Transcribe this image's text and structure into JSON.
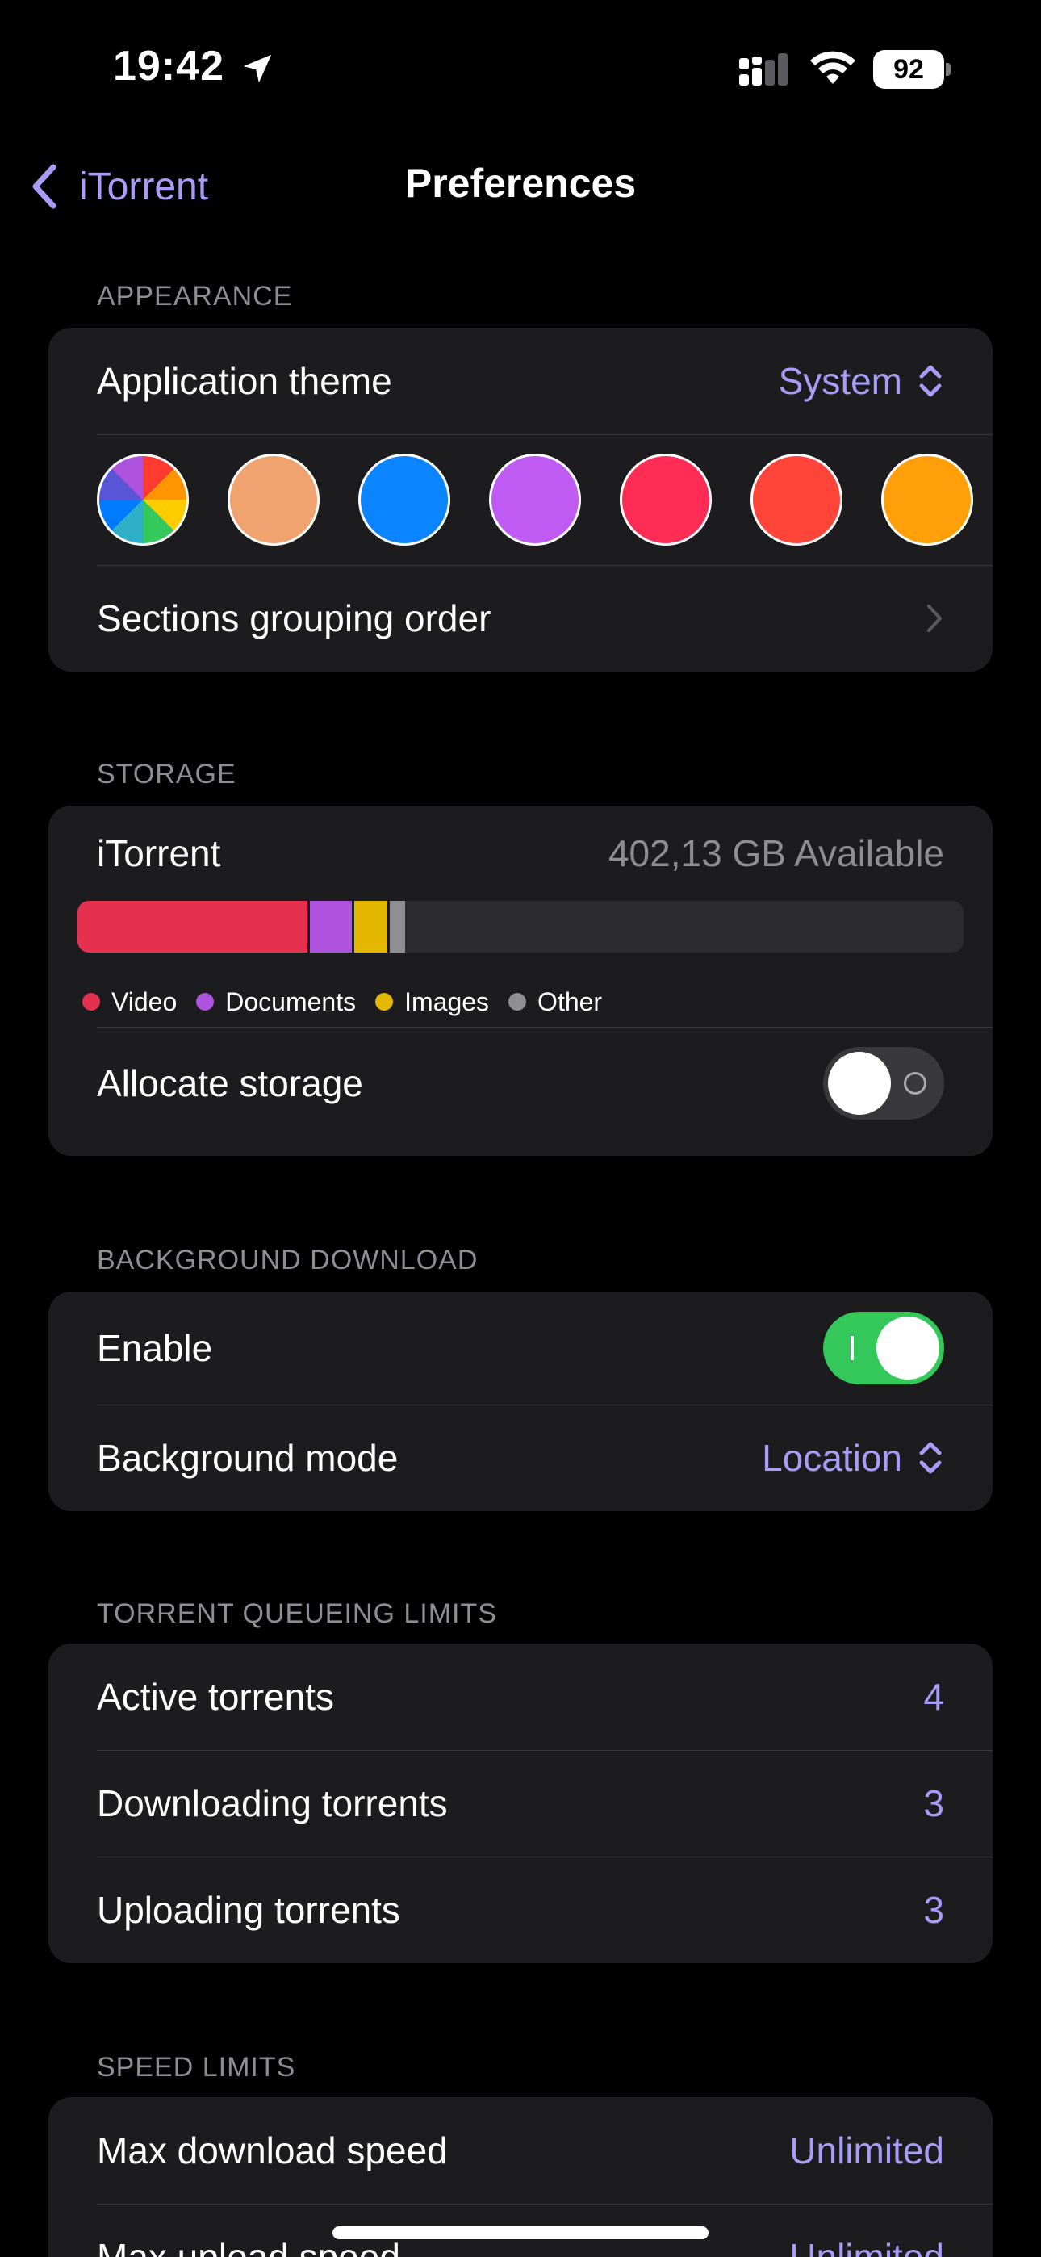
{
  "status_bar": {
    "time": "19:42",
    "battery": "92"
  },
  "nav": {
    "back_label": "iTorrent",
    "title": "Preferences"
  },
  "appearance": {
    "header": "APPEARANCE",
    "theme_label": "Application theme",
    "theme_value": "System",
    "accent_colors": [
      "multicolor",
      "#F0A26F",
      "#0A84FF",
      "#BF5AF2",
      "#FF2D55",
      "#FF453A",
      "#FF9F0A"
    ],
    "grouping_label": "Sections grouping order"
  },
  "storage": {
    "header": "STORAGE",
    "app_name": "iTorrent",
    "available": "402,13 GB Available",
    "usage": [
      {
        "name": "Video",
        "color": "#E5304F",
        "fraction": 0.26
      },
      {
        "name": "Documents",
        "color": "#AF52DE",
        "fraction": 0.05
      },
      {
        "name": "Images",
        "color": "#E4B800",
        "fraction": 0.04
      },
      {
        "name": "Other",
        "color": "#8E8E93",
        "fraction": 0.02
      }
    ],
    "allocate_label": "Allocate storage",
    "allocate_on": false
  },
  "background_download": {
    "header": "BACKGROUND DOWNLOAD",
    "enable_label": "Enable",
    "enable_on": true,
    "mode_label": "Background mode",
    "mode_value": "Location"
  },
  "queue_limits": {
    "header": "TORRENT QUEUEING LIMITS",
    "rows": [
      {
        "label": "Active torrents",
        "value": "4"
      },
      {
        "label": "Downloading torrents",
        "value": "3"
      },
      {
        "label": "Uploading torrents",
        "value": "3"
      }
    ]
  },
  "speed_limits": {
    "header": "SPEED LIMITS",
    "rows": [
      {
        "label": "Max download speed",
        "value": "Unlimited"
      },
      {
        "label": "Max upload speed",
        "value": "Unlimited"
      }
    ]
  },
  "colors": {
    "accent": "#A99CF6",
    "background": "#000000",
    "card": "#1C1C1E",
    "toggle_on": "#34C759"
  }
}
